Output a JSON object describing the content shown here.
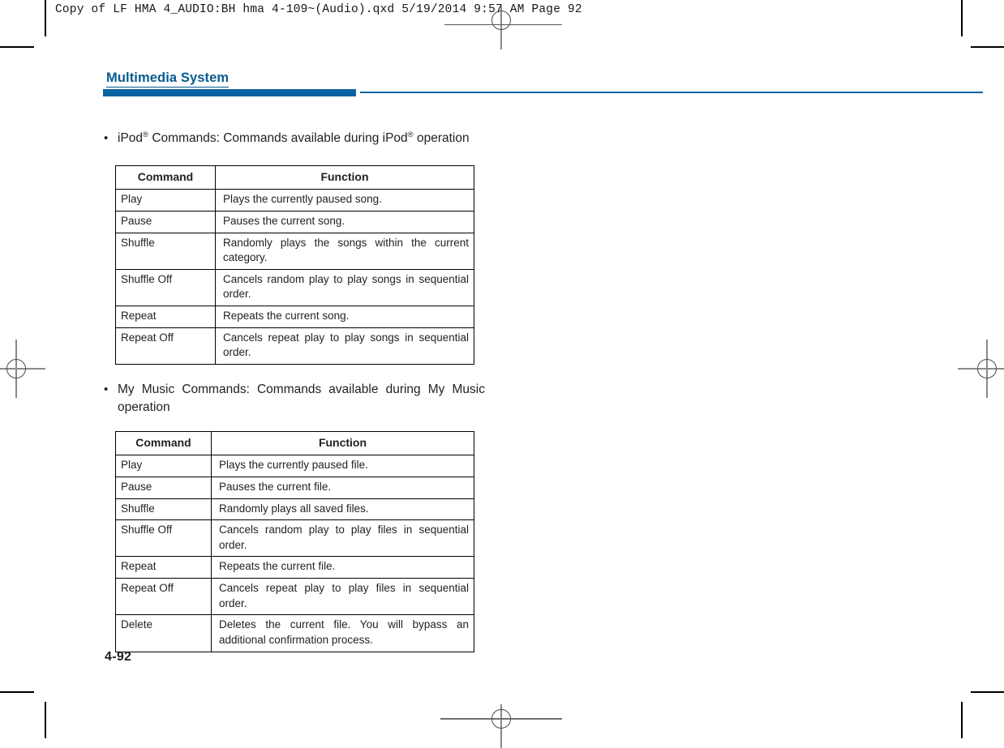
{
  "page": {
    "slug": "Copy of LF HMA 4_AUDIO:BH hma 4-109~(Audio).qxd  5/19/2014  9:57 AM  Page 92",
    "chapter_title": "Multimedia System",
    "folio": "4-92",
    "accent_color": "#0a63a0",
    "text_color": "#231f20"
  },
  "sections": [
    {
      "bullet_marker": "•",
      "bullet_text_before": "iPod",
      "bullet_sup": "®",
      "bullet_text_full": "iPod® Commands: Commands available during iPod® operation",
      "table": {
        "headers": [
          "Command",
          "Function"
        ],
        "rows": [
          [
            "Play",
            "Plays the currently paused song."
          ],
          [
            "Pause",
            "Pauses the current song."
          ],
          [
            "Shuffle",
            "Randomly plays the songs within the current category."
          ],
          [
            "Shuffle Off",
            "Cancels random play to play songs in sequential order."
          ],
          [
            "Repeat",
            "Repeats the current song."
          ],
          [
            "Repeat Off",
            "Cancels repeat play to play songs in sequential order."
          ]
        ]
      }
    },
    {
      "bullet_marker": "•",
      "bullet_text_full": "My Music Commands: Commands available during My Music operation",
      "table": {
        "headers": [
          "Command",
          "Function"
        ],
        "rows": [
          [
            "Play",
            "Plays the currently paused file."
          ],
          [
            "Pause",
            "Pauses the current file."
          ],
          [
            "Shuffle",
            "Randomly plays all saved files."
          ],
          [
            "Shuffle Off",
            "Cancels random play to play files in sequential order."
          ],
          [
            "Repeat",
            "Repeats the current file."
          ],
          [
            "Repeat Off",
            "Cancels repeat play to play files in sequential order."
          ],
          [
            "Delete",
            "Deletes the current file. You will bypass an additional confirmation process."
          ]
        ]
      }
    }
  ]
}
